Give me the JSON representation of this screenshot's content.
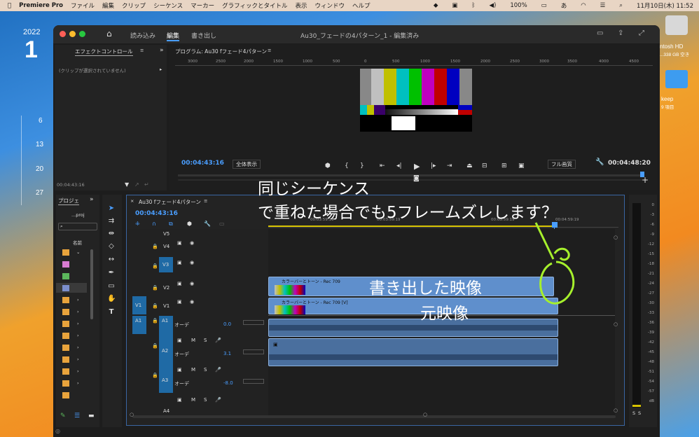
{
  "menubar": {
    "app": "Premiere Pro",
    "items": [
      "ファイル",
      "編集",
      "クリップ",
      "シーケンス",
      "マーカー",
      "グラフィックとタイトル",
      "表示",
      "ウィンドウ",
      "ヘルプ"
    ],
    "battery": "100%",
    "ime": "あ",
    "clock": "11月10日(木) 11:52"
  },
  "desktop": {
    "year": "2022",
    "big_date": "1",
    "cal_days": [
      "6",
      "13",
      "20",
      "27"
    ],
    "hd_name": "ntosh HD",
    "hd_info": "...338 GB 空き",
    "folder_name": "keep",
    "folder_info": "9 項目"
  },
  "window": {
    "tabs": {
      "import": "読み込み",
      "edit": "編集",
      "export": "書き出し"
    },
    "title": "Au30_フェードの4パターン_1 - 編集済み"
  },
  "effect_controls": {
    "tab": "エフェクトコントロール",
    "no_clip": "(クリップが選択されていません)",
    "timecode": "00:04:43:16"
  },
  "program": {
    "tab": "プログラム: Au30 fフェード4パターン",
    "ruler": [
      "3000",
      "2500",
      "2000",
      "1500",
      "1000",
      "500",
      "0",
      "500",
      "1000",
      "1500",
      "2000",
      "2500",
      "3000",
      "3500",
      "4000",
      "4500"
    ],
    "timecode": "00:04:43:16",
    "fit": "全体表示",
    "quality": "フル画質",
    "duration": "00:04:48:20"
  },
  "colors": {
    "bars": [
      "#c0c0c0",
      "#c0c000",
      "#00c0c0",
      "#00c000",
      "#c000c0",
      "#c00000",
      "#0000c0"
    ],
    "accent": "#4a9eff",
    "clip": "#5f8fcc",
    "annotation": "#a6f02c",
    "track_target": "#1f6aa5"
  },
  "project": {
    "tab": "プロジェ",
    "file": "...proj",
    "column": "名前",
    "swatches": [
      "#e8a33c",
      "#d87bd1",
      "#5cb85c",
      "#7b8ecc",
      "#e8a33c",
      "#e8a33c",
      "#e8a33c",
      "#e8a33c",
      "#e8a33c",
      "#e8a33c",
      "#e8a33c",
      "#e8a33c",
      "#e8a33c"
    ]
  },
  "timeline": {
    "tab": "Au30 fフェード4パターン",
    "timecode": "00:04:43:16",
    "ruler": [
      "00:03:59:19",
      "00:03:59:19",
      "00:03:59:19",
      "00:04:59:19"
    ],
    "tracks": {
      "v5": "V5",
      "v4": "V4",
      "v3": "V3",
      "v2": "V2",
      "v1": "V1",
      "v1_src": "V1",
      "a1": "A1",
      "a1_src": "A1",
      "a2": "A2",
      "a3": "A3",
      "a4": "A4",
      "m": "M",
      "s": "S",
      "audio_name": "オーデ",
      "a1_vol": "0.0",
      "a2_vol": "3.1",
      "a3_vol": "-8.0"
    },
    "clips": {
      "v2": "カラーバーとトーン - Rec 709",
      "v1": "カラーバーとトーン - Rec 709 [V]"
    },
    "meter": [
      "0",
      "-3",
      "-6",
      "-9",
      "-12",
      "-15",
      "-18",
      "-21",
      "-24",
      "-27",
      "-30",
      "-33",
      "-36",
      "-39",
      "-42",
      "-45",
      "-48",
      "-51",
      "-54",
      "-57",
      "dB"
    ],
    "meter_solo": "S"
  },
  "annotations": {
    "line1": "同じシーケンス",
    "line2": "で重ねた場合でも5フレームズレします？",
    "exported": "書き出した映像",
    "original": "元映像"
  }
}
